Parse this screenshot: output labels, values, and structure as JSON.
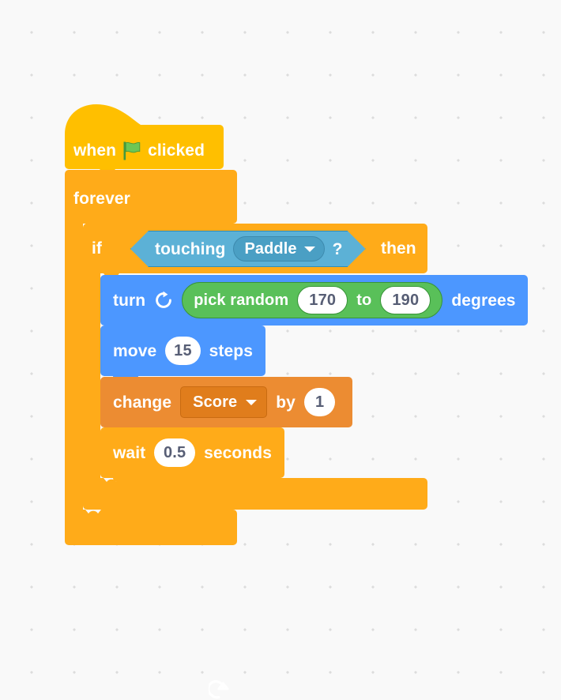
{
  "workspace": {
    "background_color": "#f9f9f9",
    "dot_color": "#dcdcdc"
  },
  "script": {
    "hat": {
      "prefix": "when",
      "icon": "green-flag-icon",
      "suffix": "clicked",
      "color": "#ffbf00"
    },
    "forever": {
      "label": "forever",
      "color": "#ffab19",
      "loop_icon": "loop-arrow-icon"
    },
    "if_block": {
      "if_label": "if",
      "then_label": "then",
      "color": "#ffab19",
      "condition": {
        "label": "touching",
        "target": "Paddle",
        "question": "?",
        "color": "#5cb1d6",
        "dropdown_icon": "chevron-down-icon"
      }
    },
    "blocks": [
      {
        "name": "turn-block",
        "label": "turn",
        "icon": "turn-clockwise-icon",
        "suffix": "degrees",
        "color": "#4c97ff",
        "reporter": {
          "label": "pick random",
          "from": "170",
          "middle": "to",
          "to": "190",
          "color": "#59c059"
        }
      },
      {
        "name": "move-block",
        "label": "move",
        "value": "15",
        "suffix": "steps",
        "color": "#4c97ff"
      },
      {
        "name": "change-block",
        "label": "change",
        "variable": "Score",
        "middle": "by",
        "value": "1",
        "color": "#ec8c32",
        "dropdown_icon": "chevron-down-icon"
      },
      {
        "name": "wait-block",
        "label": "wait",
        "value": "0.5",
        "suffix": "seconds",
        "color": "#ffab19"
      }
    ]
  }
}
